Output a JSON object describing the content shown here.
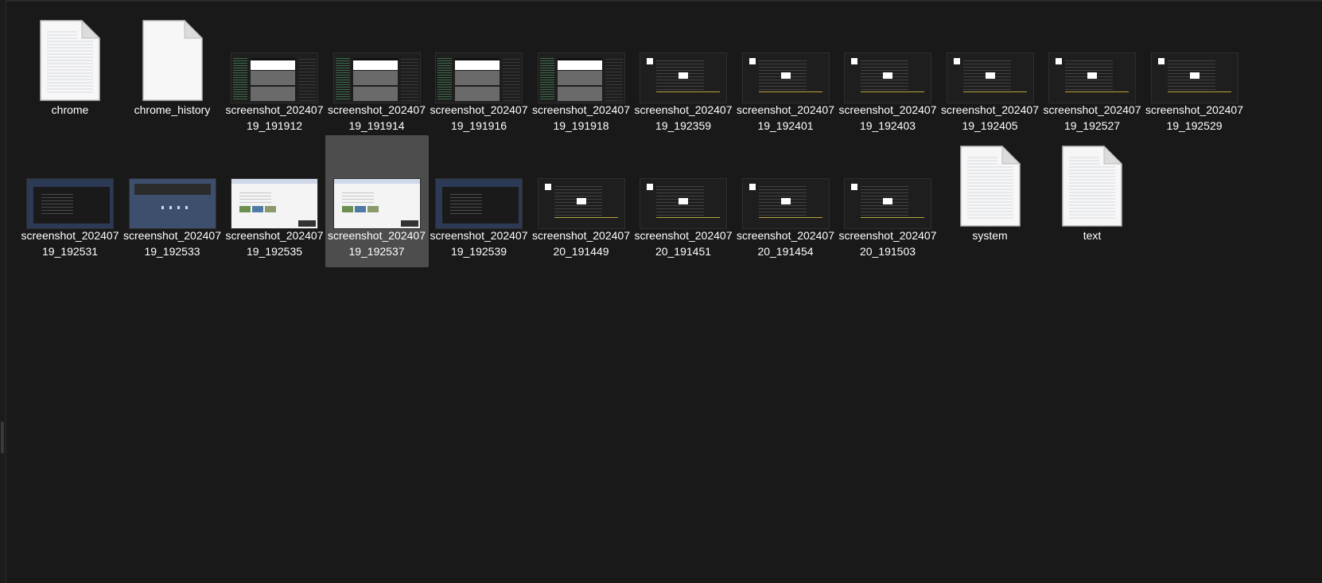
{
  "window": {
    "background": "#191919",
    "selected_background": "#4d4d4d",
    "text_color": "#ffffff"
  },
  "files": [
    {
      "name": "chrome",
      "kind": "document",
      "icon": "lined-document-icon",
      "row": 0,
      "col": 0
    },
    {
      "name": "chrome_history",
      "kind": "document",
      "icon": "blank-document-icon",
      "row": 0,
      "col": 1
    },
    {
      "name": "screenshot_20240719_191912",
      "kind": "image",
      "thumb": "a",
      "row": 0,
      "col": 2
    },
    {
      "name": "screenshot_20240719_191914",
      "kind": "image",
      "thumb": "a",
      "row": 0,
      "col": 3
    },
    {
      "name": "screenshot_20240719_191916",
      "kind": "image",
      "thumb": "a",
      "row": 0,
      "col": 4
    },
    {
      "name": "screenshot_20240719_191918",
      "kind": "image",
      "thumb": "a",
      "row": 0,
      "col": 5
    },
    {
      "name": "screenshot_20240719_192359",
      "kind": "image",
      "thumb": "b",
      "row": 0,
      "col": 6
    },
    {
      "name": "screenshot_20240719_192401",
      "kind": "image",
      "thumb": "b",
      "row": 0,
      "col": 7
    },
    {
      "name": "screenshot_20240719_192403",
      "kind": "image",
      "thumb": "b",
      "row": 0,
      "col": 8
    },
    {
      "name": "screenshot_20240719_192405",
      "kind": "image",
      "thumb": "b",
      "row": 0,
      "col": 9
    },
    {
      "name": "screenshot_20240719_192527",
      "kind": "image",
      "thumb": "b",
      "row": 0,
      "col": 10
    },
    {
      "name": "screenshot_20240719_192529",
      "kind": "image",
      "thumb": "b",
      "row": 0,
      "col": 11
    },
    {
      "name": "screenshot_20240719_192531",
      "kind": "image",
      "thumb": "c",
      "row": 1,
      "col": 0
    },
    {
      "name": "screenshot_20240719_192533",
      "kind": "image",
      "thumb": "e",
      "row": 1,
      "col": 1
    },
    {
      "name": "screenshot_20240719_192535",
      "kind": "image",
      "thumb": "d",
      "row": 1,
      "col": 2
    },
    {
      "name": "screenshot_20240719_192537",
      "kind": "image",
      "thumb": "d",
      "row": 1,
      "col": 3,
      "selected": true
    },
    {
      "name": "screenshot_20240719_192539",
      "kind": "image",
      "thumb": "c",
      "row": 1,
      "col": 4
    },
    {
      "name": "screenshot_20240720_191449",
      "kind": "image",
      "thumb": "b",
      "row": 1,
      "col": 5
    },
    {
      "name": "screenshot_20240720_191451",
      "kind": "image",
      "thumb": "b",
      "row": 1,
      "col": 6
    },
    {
      "name": "screenshot_20240720_191454",
      "kind": "image",
      "thumb": "b",
      "row": 1,
      "col": 7
    },
    {
      "name": "screenshot_20240720_191503",
      "kind": "image",
      "thumb": "b",
      "row": 1,
      "col": 8
    },
    {
      "name": "system",
      "kind": "document",
      "icon": "lined-document-icon",
      "row": 1,
      "col": 9
    },
    {
      "name": "text",
      "kind": "document",
      "icon": "lined-document-icon",
      "row": 1,
      "col": 10
    }
  ]
}
